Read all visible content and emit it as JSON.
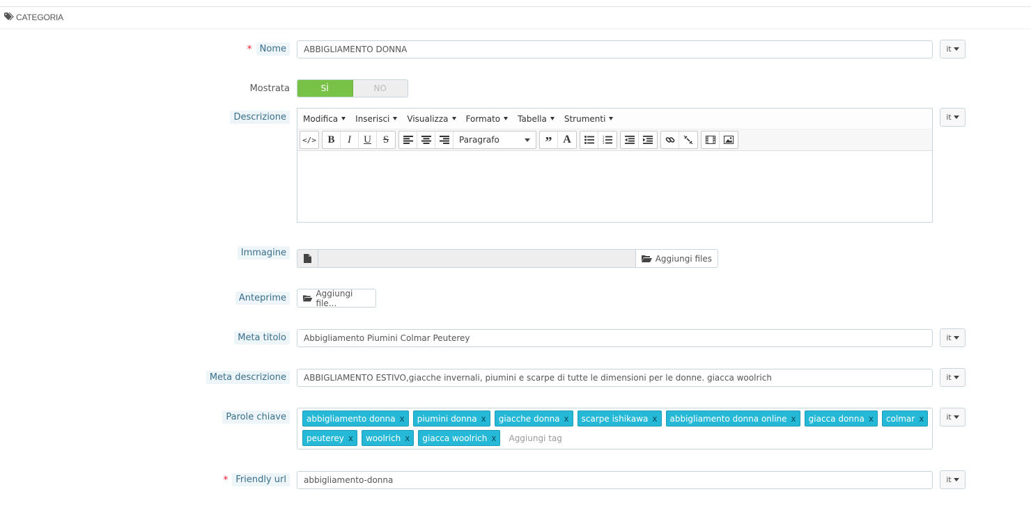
{
  "panel": {
    "title": "CATEGORIA",
    "icon": "tag-icon"
  },
  "fields": {
    "name": {
      "label": "Nome",
      "required_mark": "*",
      "value": "ABBIGLIAMENTO DONNA",
      "lang": "it"
    },
    "displayed": {
      "label": "Mostrata",
      "yes": "SÌ",
      "no": "NO",
      "selected": "yes"
    },
    "description": {
      "label": "Descrizione",
      "lang": "it",
      "menu": [
        "Modifica",
        "Inserisci",
        "Visualizza",
        "Formato",
        "Tabella",
        "Strumenti"
      ],
      "format_select": "Paragrafo",
      "toolbar_icons": [
        "code-icon",
        "bold-icon",
        "italic-icon",
        "underline-icon",
        "strikethrough-icon",
        "align-left-icon",
        "align-center-icon",
        "align-right-icon",
        "blockquote-icon",
        "text-color-icon",
        "bullet-list-icon",
        "numbered-list-icon",
        "outdent-icon",
        "indent-icon",
        "link-icon",
        "unlink-icon",
        "media-icon",
        "image-icon"
      ]
    },
    "image": {
      "label": "Immagine",
      "button": "Aggiungi files"
    },
    "thumbnails": {
      "label": "Anteprime",
      "button": "Aggiungi file..."
    },
    "meta_title": {
      "label": "Meta titolo",
      "value": "Abbigliamento Piumini Colmar Peuterey",
      "lang": "it"
    },
    "meta_description": {
      "label": "Meta descrizione",
      "value": "ABBIGLIAMENTO ESTIVO,giacche invernali, piumini e scarpe di tutte le dimensioni per le donne. giacca woolrich",
      "lang": "it"
    },
    "keywords": {
      "label": "Parole chiave",
      "lang": "it",
      "tags": [
        "abbigliamento donna",
        "piumini donna",
        "giacche donna",
        "scarpe ishikawa",
        "abbigliamento donna online",
        "giacca donna",
        "colmar",
        "peuterey",
        "woolrich",
        "giacca woolrich"
      ],
      "remove_symbol": "x",
      "placeholder": "Aggiungi tag"
    },
    "friendly_url": {
      "label": "Friendly url",
      "required_mark": "*",
      "value": "abbigliamento-donna",
      "lang": "it"
    }
  },
  "colors": {
    "switch_on": "#78c347",
    "tag_bg": "#25b9d7",
    "required": "#ee2233",
    "label_help_bg": "#edf5f8"
  }
}
